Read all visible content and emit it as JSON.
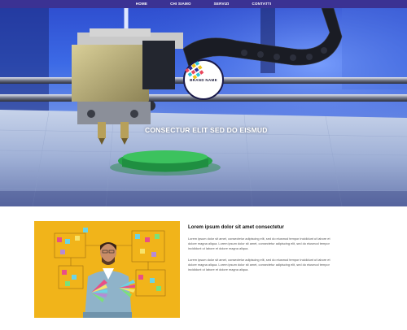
{
  "nav": {
    "items": [
      {
        "label": "HOME"
      },
      {
        "label": "CHI SIAMO"
      },
      {
        "label": "SERVIZI"
      },
      {
        "label": "CONTATTI"
      }
    ],
    "bg_color": "#3b3293"
  },
  "hero": {
    "brand_name": "BRAND NAME",
    "title": "CONSECTUR ELIT SED DO EISMUD",
    "image_subject": "3D printer extruder printing green object"
  },
  "content": {
    "title": "Lorem ipsum dolor sit amet consectetur",
    "paragraphs": [
      "Lorem ipsum dolor sit amet, consectetur adipiscing elit, sed do eiusmod tempor incididunt ut labore et dolore magna aliqua. Lorem ipsum dolor sit amet, consectetur adipiscing elit, sed do eiusmod tempor incididunt ut labore et dolore magna aliqua.",
      "Lorem ipsum dolor sit amet, consectetur adipiscing elit, sed do eiusmod tempor incididunt ut labore et dolore magna aliqua. Lorem ipsum dolor sit amet, consectetur adipiscing elit, sed do eiusmod tempor incididunt ut labore et dolore magna aliqua."
    ],
    "image_subject": "man holding color swatches in front of yellow wall with sticky notes"
  }
}
